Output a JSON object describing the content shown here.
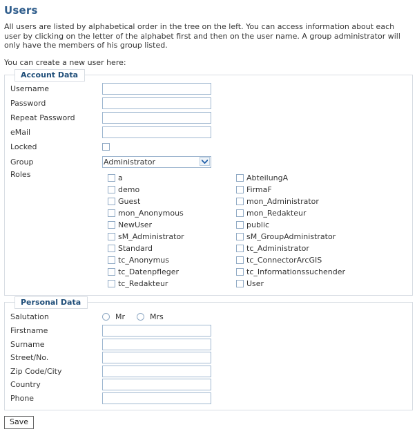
{
  "page": {
    "title": "Users",
    "intro": "All users are listed by alphabetical order in the tree on the left. You can access information about each user by clicking on the letter of the alphabet first and then on the user name. A group administrator will only have the members of his group listed.",
    "intro_2": "You can create a new user here:"
  },
  "account_data": {
    "legend": "Account Data",
    "fields": [
      {
        "label": "Username",
        "type": "text",
        "value": "",
        "placeholder": ""
      },
      {
        "label": "Password",
        "type": "text",
        "value": "",
        "placeholder": ""
      },
      {
        "label": "Repeat Password",
        "type": "text",
        "value": "",
        "placeholder": ""
      },
      {
        "label": "eMail",
        "type": "text",
        "value": "",
        "placeholder": ""
      }
    ],
    "locked_label": "Locked",
    "locked_checked": false,
    "group_label": "Group",
    "group_selected": "Administrator",
    "group_options": [
      "Administrator"
    ],
    "roles_label": "Roles",
    "roles_left": [
      {
        "label": "a",
        "checked": false
      },
      {
        "label": "demo",
        "checked": false
      },
      {
        "label": "Guest",
        "checked": false
      },
      {
        "label": "mon_Anonymous",
        "checked": false
      },
      {
        "label": "NewUser",
        "checked": false
      },
      {
        "label": "sM_Administrator",
        "checked": false
      },
      {
        "label": "Standard",
        "checked": false
      },
      {
        "label": "tc_Anonymus",
        "checked": false
      },
      {
        "label": "tc_Datenpfleger",
        "checked": false
      },
      {
        "label": "tc_Redakteur",
        "checked": false
      }
    ],
    "roles_right": [
      {
        "label": "AbteilungA",
        "checked": false
      },
      {
        "label": "FirmaF",
        "checked": false
      },
      {
        "label": "mon_Administrator",
        "checked": false
      },
      {
        "label": "mon_Redakteur",
        "checked": false
      },
      {
        "label": "public",
        "checked": false
      },
      {
        "label": "sM_GroupAdministrator",
        "checked": false
      },
      {
        "label": "tc_Administrator",
        "checked": false
      },
      {
        "label": "tc_ConnectorArcGIS",
        "checked": false
      },
      {
        "label": "tc_Informationssuchender",
        "checked": false
      },
      {
        "label": "User",
        "checked": false
      }
    ]
  },
  "personal_data": {
    "legend": "Personal Data",
    "salutation_label": "Salutation",
    "salutation_options": [
      {
        "label": "Mr",
        "selected": false
      },
      {
        "label": "Mrs",
        "selected": false
      }
    ],
    "fields": [
      {
        "label": "Firstname",
        "value": "",
        "placeholder": ""
      },
      {
        "label": "Surname",
        "value": "",
        "placeholder": ""
      },
      {
        "label": "Street/No.",
        "value": "",
        "placeholder": ""
      },
      {
        "label": "Zip Code/City",
        "value": "",
        "placeholder": ""
      },
      {
        "label": "Country",
        "value": "",
        "placeholder": ""
      },
      {
        "label": "Phone",
        "value": "",
        "placeholder": ""
      }
    ]
  },
  "actions": {
    "save_label": "Save"
  },
  "colors": {
    "title": "#2f5d8c",
    "legend": "#1f4e79",
    "field_border": "#9fb7d0",
    "fieldset_border": "#d8dde3",
    "text": "#333333"
  }
}
